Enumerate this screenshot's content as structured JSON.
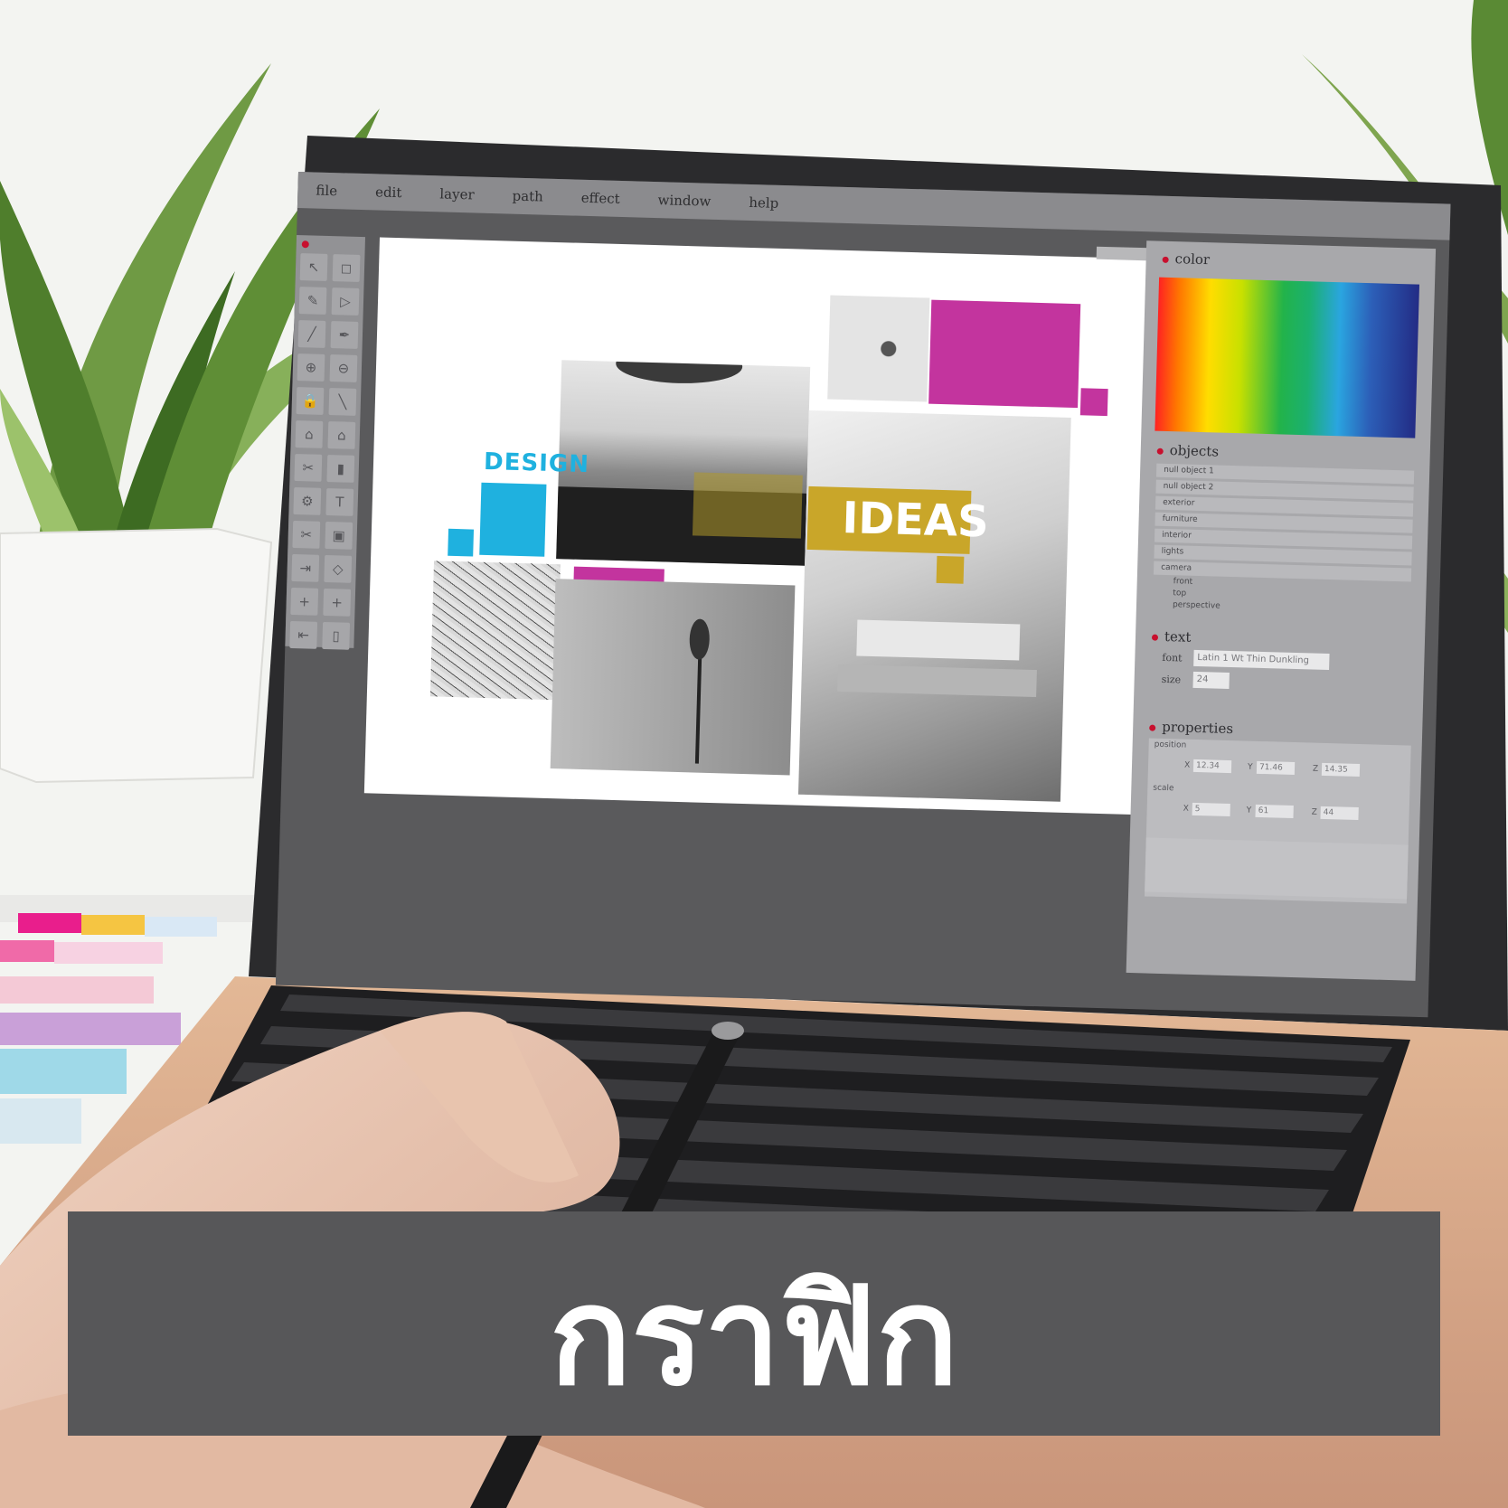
{
  "menu": [
    "file",
    "edit",
    "layer",
    "path",
    "effect",
    "window",
    "help"
  ],
  "tools": [
    "arrow-icon",
    "select-icon",
    "pencil-icon",
    "shape-icon",
    "brush-icon",
    "pen-icon",
    "zoom-in-icon",
    "zoom-out-icon",
    "lock-icon",
    "line-icon",
    "home-icon",
    "house-icon",
    "scissors-icon",
    "trash-icon",
    "gear-icon",
    "text-icon",
    "cut-icon",
    "save-icon",
    "export-icon",
    "rotate-icon",
    "plus-icon",
    "plus-alt-icon",
    "import-icon",
    "delete-icon"
  ],
  "tool_glyphs": [
    "↖",
    "◻",
    "✎",
    "▷",
    "╱",
    "✒",
    "⊕",
    "⊖",
    "🔒",
    "╲",
    "⌂",
    "⌂",
    "✂",
    "▮",
    "⚙",
    "T",
    "✂",
    "▣",
    "⇥",
    "◇",
    "+",
    "+",
    "⇤",
    "▯"
  ],
  "moodboard": {
    "word_left": "DESIGN",
    "word_right": "IDEAS"
  },
  "panel": {
    "color_heading": "color",
    "objects_heading": "objects",
    "objects": [
      "null object 1",
      "null object 2",
      "exterior",
      "furniture",
      "interior",
      "lights",
      "camera"
    ],
    "camera_children": [
      "front",
      "top",
      "perspective"
    ],
    "text_heading": "text",
    "font_label": "font",
    "font_value": "Latin 1 Wt Thin Dunkling",
    "size_label": "size",
    "size_value": "24",
    "properties_heading": "properties",
    "position_label": "position",
    "position": {
      "x": "12.34",
      "y": "71.46",
      "z": "14.35"
    },
    "scale_label": "scale",
    "scale": {
      "x": "5",
      "y": "61",
      "z": "44"
    },
    "axis_x": "X",
    "axis_y": "Y",
    "axis_z": "Z"
  },
  "banner": {
    "title": "กราฟิก"
  },
  "colors": {
    "magenta": "#c3349e",
    "cyan": "#1fb1df",
    "gold": "#c9a629",
    "banner_bg": "#575759",
    "accent_dot": "#c8102e"
  }
}
